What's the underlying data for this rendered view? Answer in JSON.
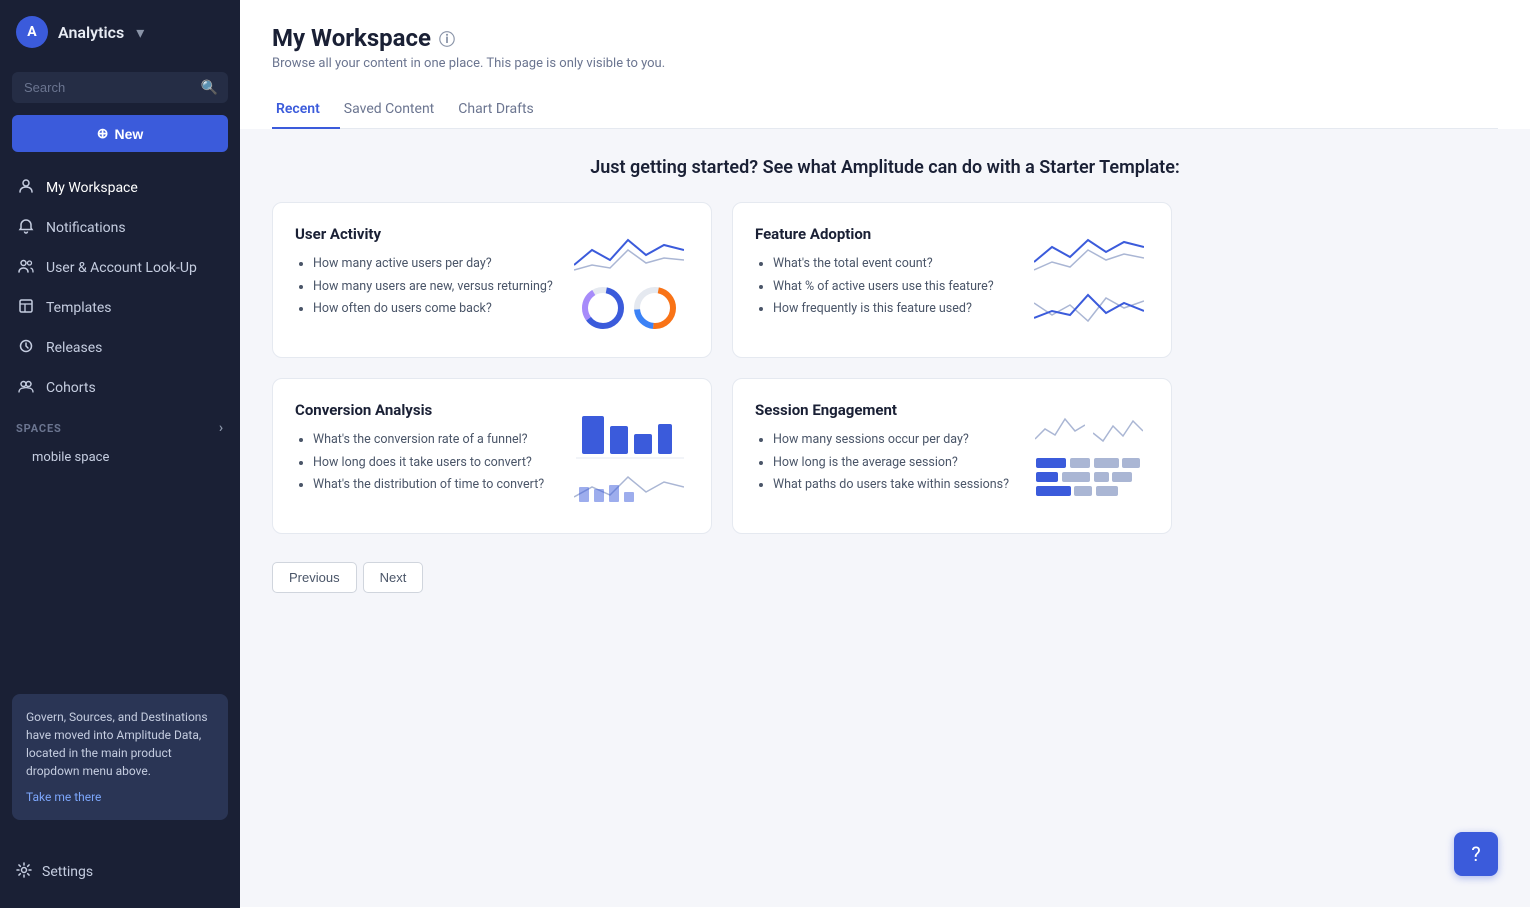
{
  "app": {
    "logo_initials": "A",
    "name": "Analytics",
    "chevron": "▾"
  },
  "search": {
    "placeholder": "Search"
  },
  "new_button": {
    "label": "New",
    "icon": "⊕"
  },
  "nav": {
    "items": [
      {
        "id": "my-workspace",
        "label": "My Workspace",
        "icon": "👤"
      },
      {
        "id": "notifications",
        "label": "Notifications",
        "icon": "🔔"
      },
      {
        "id": "user-account-lookup",
        "label": "User & Account Look-Up",
        "icon": "👥"
      },
      {
        "id": "templates",
        "label": "Templates",
        "icon": "📄"
      },
      {
        "id": "releases",
        "label": "Releases",
        "icon": "🚀"
      },
      {
        "id": "cohorts",
        "label": "Cohorts",
        "icon": "👥"
      }
    ]
  },
  "spaces": {
    "label": "SPACES",
    "items": [
      {
        "id": "mobile-space",
        "label": "mobile space"
      }
    ]
  },
  "settings": {
    "label": "Settings",
    "icon": "⚙"
  },
  "notification_banner": {
    "text": "Govern, Sources, and Destinations have moved into Amplitude Data, located in the main product dropdown menu above.",
    "link_label": "Take me there"
  },
  "page": {
    "title": "My Workspace",
    "info_icon": "ⓘ",
    "subtitle": "Browse all your content in one place. This page is only visible to you."
  },
  "tabs": [
    {
      "id": "recent",
      "label": "Recent",
      "active": true
    },
    {
      "id": "saved-content",
      "label": "Saved Content",
      "active": false
    },
    {
      "id": "chart-drafts",
      "label": "Chart Drafts",
      "active": false
    }
  ],
  "starter_heading": "Just getting started? See what Amplitude can do with a Starter Template:",
  "templates": [
    {
      "id": "user-activity",
      "title": "User Activity",
      "bullets": [
        "How many active users per day?",
        "How many users are new, versus returning?",
        "How often do users come back?"
      ],
      "visual_type": "line-donut"
    },
    {
      "id": "feature-adoption",
      "title": "Feature Adoption",
      "bullets": [
        "What's the total event count?",
        "What % of active users use this feature?",
        "How frequently is this feature used?"
      ],
      "visual_type": "line-line"
    },
    {
      "id": "conversion-analysis",
      "title": "Conversion Analysis",
      "bullets": [
        "What's the conversion rate of a funnel?",
        "How long does it take users to convert?",
        "What's the distribution of time to convert?"
      ],
      "visual_type": "bar-line"
    },
    {
      "id": "session-engagement",
      "title": "Session Engagement",
      "bullets": [
        "How many sessions occur per day?",
        "How long is the average session?",
        "What paths do users take within sessions?"
      ],
      "visual_type": "wave-grid"
    }
  ],
  "pagination": {
    "previous": "Previous",
    "next": "Next"
  },
  "help_button": "?"
}
